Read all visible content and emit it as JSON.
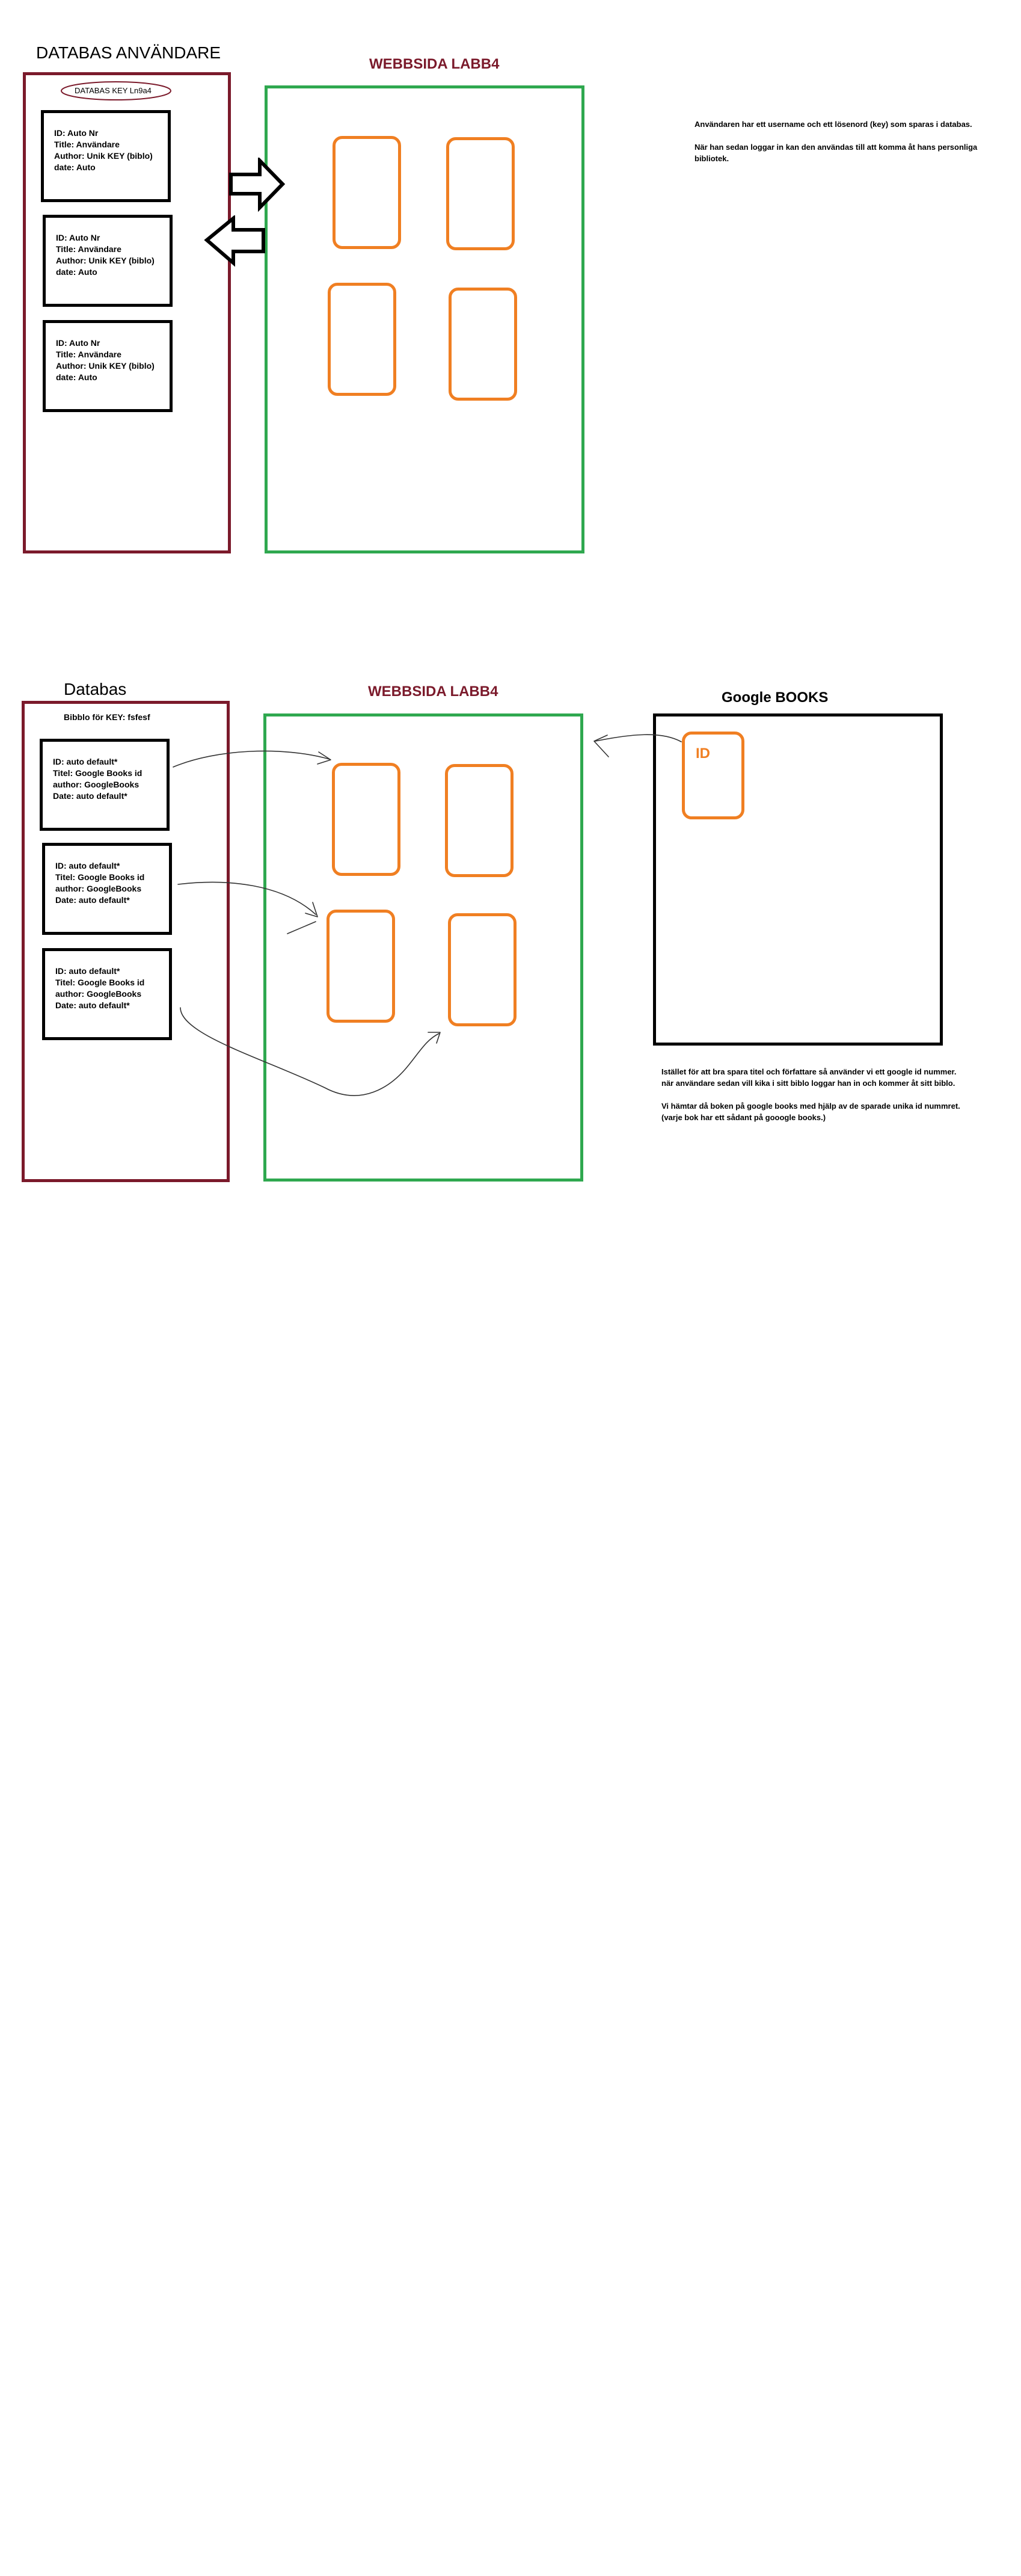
{
  "colors": {
    "database_border": "#7b1a2b",
    "webpage_border": "#2fa84f",
    "google_border": "#000000",
    "card_border": "#f07f22",
    "webpage_title": "#7b1a2b"
  },
  "section1": {
    "db_title": "DATABAS ANVÄNDARE",
    "db_key_label": "DATABAS KEY  Ln9a4",
    "web_title": "WEBBSIDA LABB4",
    "records": [
      {
        "lines": [
          "ID: Auto Nr",
          "Title: Användare",
          "Author: Unik KEY (biblo)",
          "date: Auto"
        ]
      },
      {
        "lines": [
          "ID: Auto Nr",
          "Title: Användare",
          "Author: Unik KEY (biblo)",
          "date: Auto"
        ]
      },
      {
        "lines": [
          "ID: Auto Nr",
          "Title: Användare",
          "Author: Unik KEY (biblo)",
          "date: Auto"
        ]
      }
    ],
    "note": [
      "Användaren har ett username och ett lösenord (key) som sparas i databas.",
      "När han sedan loggar in kan den användas till att komma åt hans personliga bibliotek."
    ]
  },
  "section2": {
    "db_title": "Databas",
    "db_subtitle": "Bibblo för KEY: fsfesf",
    "web_title": "WEBBSIDA LABB4",
    "google_title": "Google BOOKS",
    "google_card_label": "ID",
    "records": [
      {
        "lines": [
          "ID: auto default*",
          "Titel: Google Books id",
          "author: GoogleBooks",
          "Date: auto default*"
        ]
      },
      {
        "lines": [
          "ID: auto default*",
          "Titel: Google Books id",
          "author: GoogleBooks",
          "Date: auto default*"
        ]
      },
      {
        "lines": [
          "ID: auto default*",
          "Titel: Google Books id",
          "author: GoogleBooks",
          "Date: auto default*"
        ]
      }
    ],
    "note": [
      "Istället för att bra spara titel och författare så använder vi ett google id nummer. när användare sedan vill kika i sitt biblo loggar han in och kommer åt sitt biblo.",
      "Vi hämtar då boken på google books med hjälp av de sparade unika id nummret. (varje bok har ett sådant på gooogle books.)"
    ]
  }
}
